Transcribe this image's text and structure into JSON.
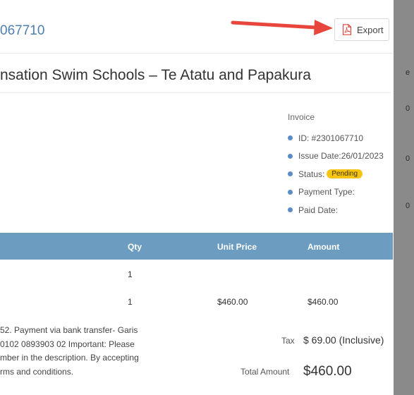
{
  "header": {
    "invoice_number_fragment": "067710",
    "export_label": "Export"
  },
  "school_title_fragment": "nsation Swim Schools – Te Atatu and Papakura",
  "invoice_meta": {
    "heading": "Invoice",
    "id_text": "ID: #2301067710",
    "issue_date_text": "Issue Date:26/01/2023",
    "status_label": "Status:",
    "status_value": "Pending",
    "payment_type_label": "Payment Type:",
    "paid_date_label": "Paid Date:"
  },
  "table": {
    "headers": {
      "qty": "Qty",
      "unit_price": "Unit Price",
      "amount": "Amount"
    },
    "rows": [
      {
        "qty": "1",
        "unit_price": "",
        "amount": ""
      },
      {
        "qty": "1",
        "unit_price": "$460.00",
        "amount": "$460.00"
      }
    ]
  },
  "note_lines": [
    "52. Payment via bank transfer- Garis",
    "0102 0893903 02 Important: Please",
    "mber in the description. By accepting",
    "rms and conditions."
  ],
  "totals": {
    "tax_label": "Tax",
    "tax_value": "$ 69.00 (Inclusive)",
    "total_label": "Total Amount",
    "total_value": "$460.00"
  },
  "colors": {
    "accent_blue": "#4d7fb0",
    "table_header": "#6c9cc0",
    "pending_badge": "#f7c413",
    "arrow_red": "#e8453c"
  }
}
